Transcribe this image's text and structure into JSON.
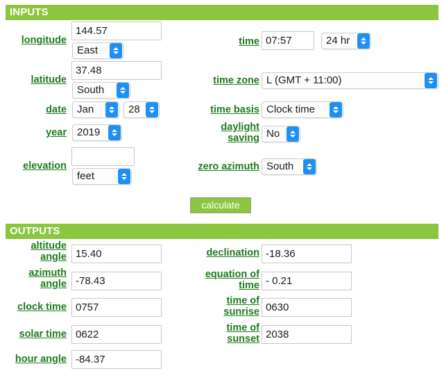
{
  "sections": {
    "inputs_title": "INPUTS",
    "outputs_title": "OUTPUTS"
  },
  "inputs": {
    "longitude": {
      "label": "longitude",
      "value": "144.57",
      "hemisphere": "East"
    },
    "latitude": {
      "label": "latitude",
      "value": "37.48",
      "hemisphere": "South"
    },
    "date": {
      "label": "date",
      "month": "Jan",
      "day": "28"
    },
    "year": {
      "label": "year",
      "value": "2019"
    },
    "elevation": {
      "label": "elevation",
      "value": "",
      "units": "feet"
    },
    "time": {
      "label": "time",
      "value": "07:57",
      "format": "24 hr"
    },
    "time_zone": {
      "label": "time zone",
      "value": "L (GMT + 11:00)"
    },
    "time_basis": {
      "label": "time basis",
      "value": "Clock time"
    },
    "daylight_saving": {
      "label": "daylight\nsaving",
      "value": "No"
    },
    "zero_azimuth": {
      "label": "zero azimuth",
      "value": "South"
    }
  },
  "actions": {
    "calculate": "calculate"
  },
  "outputs": {
    "altitude_angle": {
      "label": "altitude\nangle",
      "value": "15.40"
    },
    "azimuth_angle": {
      "label": "azimuth\nangle",
      "value": "-78.43"
    },
    "clock_time": {
      "label": "clock time",
      "value": "0757"
    },
    "solar_time": {
      "label": "solar time",
      "value": "0622"
    },
    "hour_angle": {
      "label": "hour angle",
      "value": "-84.37"
    },
    "declination": {
      "label": "declination",
      "value": "-18.36"
    },
    "equation_of_time": {
      "label": "equation of\ntime",
      "value": "- 0.21"
    },
    "time_of_sunrise": {
      "label": "time of\nsunrise",
      "value": "0630"
    },
    "time_of_sunset": {
      "label": "time of\nsunset",
      "value": "2038"
    }
  },
  "colors": {
    "section_bar": "#8cc63e",
    "label_green": "#1e7b1e",
    "select_arrow_blue": "#1e90f3"
  }
}
